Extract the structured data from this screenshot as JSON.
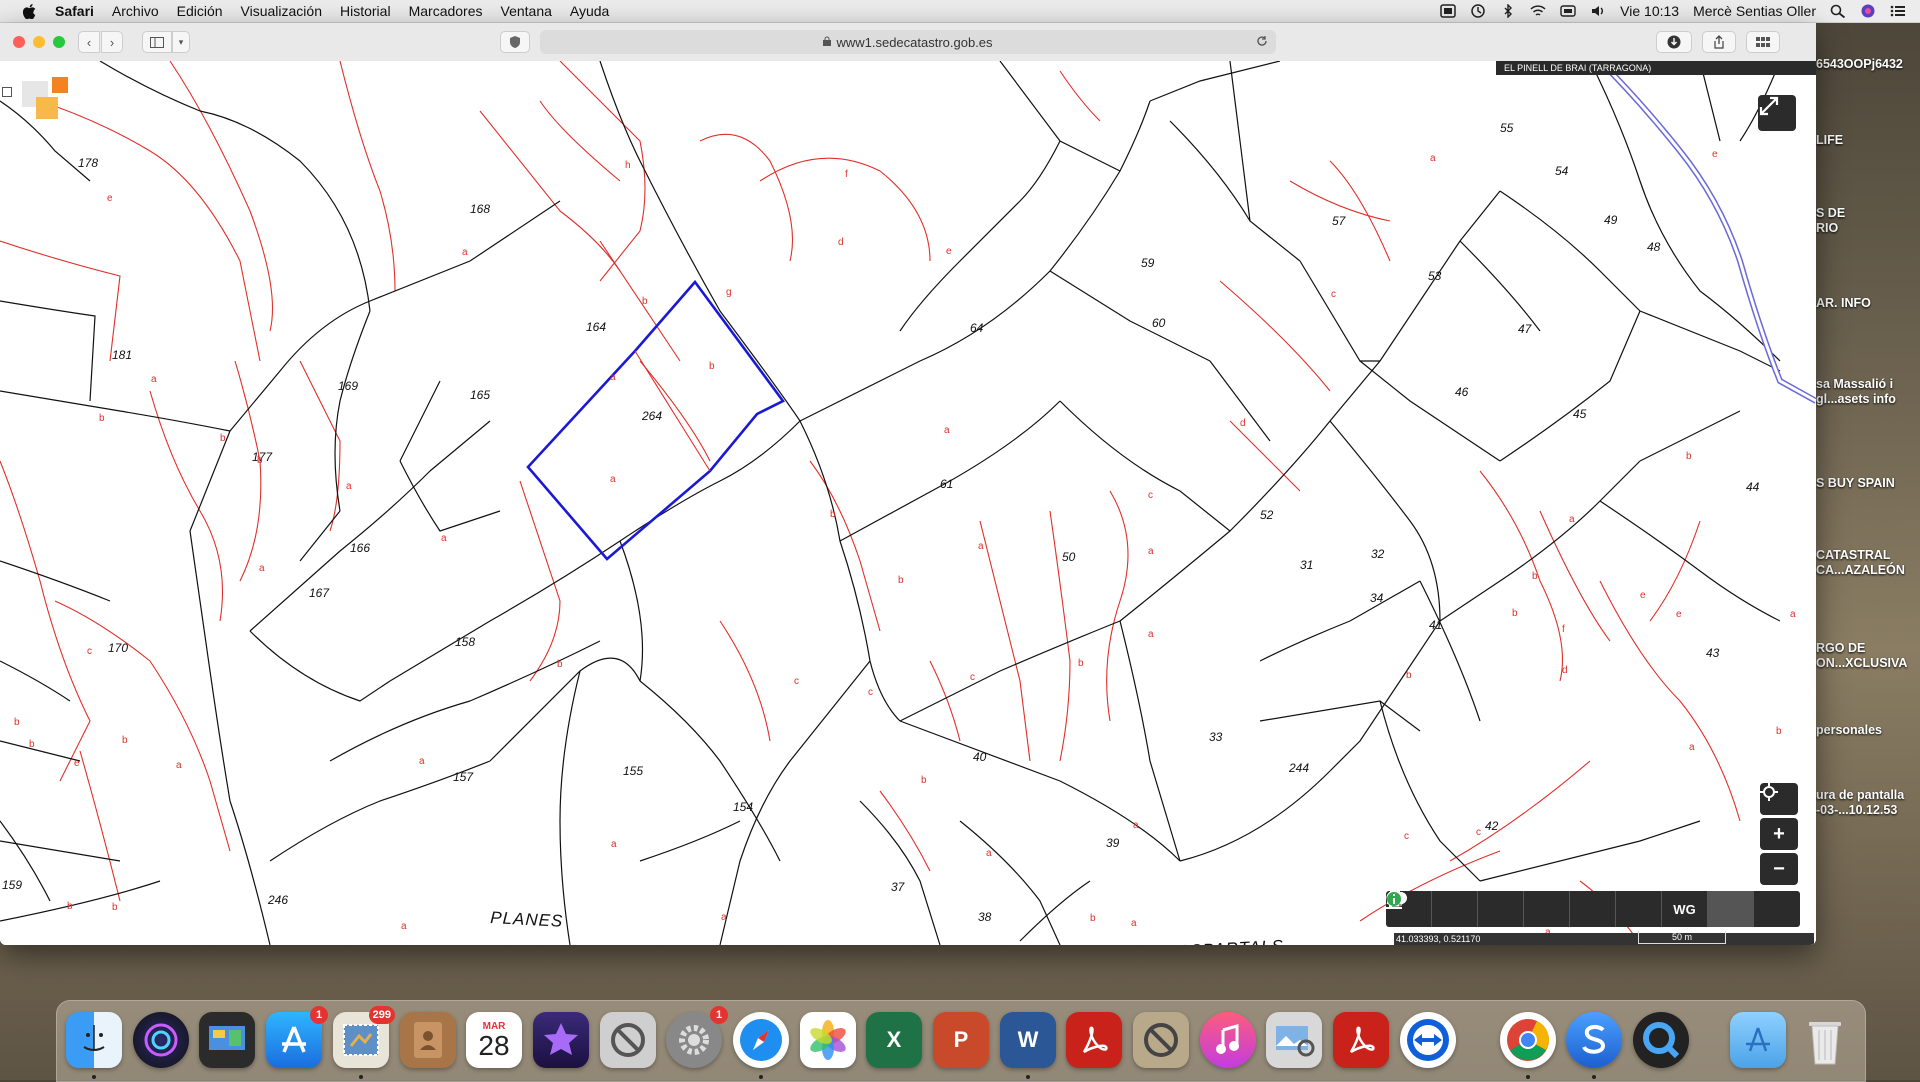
{
  "menubar": {
    "app": "Safari",
    "items": [
      "Archivo",
      "Edición",
      "Visualización",
      "Historial",
      "Marcadores",
      "Ventana",
      "Ayuda"
    ],
    "clock": "Vie 10:13",
    "user": "Mercè Sentias Oller"
  },
  "browser": {
    "url": "www1.sedecatastro.gob.es"
  },
  "map": {
    "municipality": "EL PINELL DE BRAI (TARRAGONA)",
    "coordinates": "41.033393, 0.521170",
    "scale": "50 m",
    "place_names": [
      "PLANES",
      "ASPARTALS"
    ],
    "selected_parcel": "264",
    "parcels": [
      "178",
      "168",
      "181",
      "169",
      "165",
      "164",
      "264",
      "177",
      "166",
      "167",
      "170",
      "158",
      "157",
      "155",
      "154",
      "246",
      "159",
      "61",
      "64",
      "59",
      "60",
      "57",
      "55",
      "54",
      "49",
      "48",
      "53",
      "47",
      "46",
      "45",
      "44",
      "52",
      "50",
      "31",
      "32",
      "34",
      "41",
      "43",
      "33",
      "244",
      "40",
      "39",
      "42",
      "37",
      "38"
    ],
    "subparcels": [
      "a",
      "b",
      "c",
      "d",
      "e",
      "f",
      "g",
      "h"
    ],
    "tools": [
      "next-icon",
      "search-icon",
      "layers-icon",
      "measure-icon",
      "print-icon",
      "parcel-icon",
      "WG",
      "photo-icon",
      "info-icon"
    ]
  },
  "desktop_items": [
    "6543OOPj6432",
    "LIFE",
    "S DE",
    "RIO",
    "AR. INFO",
    "sa Massalió i",
    "gl...asets info",
    "S BUY SPAIN",
    "CATASTRAL",
    "CA...AZALEÓN",
    "RGO DE",
    "ON...XCLUSIVA",
    "personales",
    "ura de pantalla",
    "-03-...10.12.53"
  ],
  "dock": {
    "badges": {
      "appstore": "1",
      "mail": "299",
      "preferences": "1"
    },
    "calendar_month": "MAR",
    "calendar_day": "28",
    "excel": "X",
    "powerpoint": "P",
    "word": "W"
  },
  "colors": {
    "parcel_line": "#111111",
    "subparcel_line": "#e0302a",
    "selection": "#1a1ad6",
    "road": "#6a6ad8"
  }
}
